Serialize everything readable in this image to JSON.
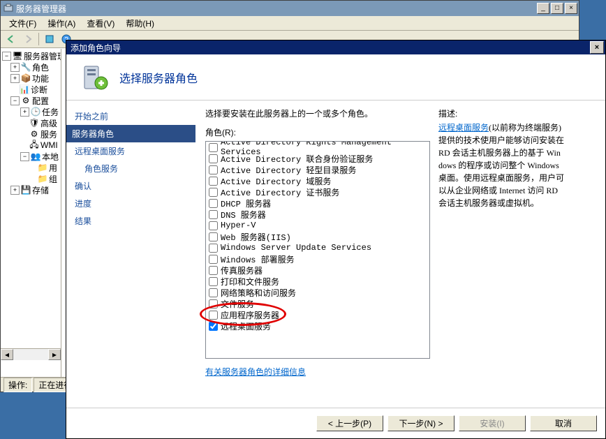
{
  "parent": {
    "title": "服务器管理器",
    "menu": {
      "file": "文件(F)",
      "action": "操作(A)",
      "view": "查看(V)",
      "help": "帮助(H)"
    },
    "status_label": "操作:",
    "status_value": "正在进行"
  },
  "tree": {
    "root": "服务器管理",
    "roles": "角色",
    "features": "功能",
    "diag": "诊断",
    "config": "配置",
    "task": "任务",
    "adv": "高级",
    "svc": "服务",
    "wmi": "WMI",
    "local": "本地",
    "usr": "用",
    "grp": "组",
    "storage": "存储"
  },
  "dialog": {
    "title": "添加角色向导",
    "heading": "选择服务器角色",
    "nav": {
      "before": "开始之前",
      "roles": "服务器角色",
      "rds": "远程桌面服务",
      "rsvc": "角色服务",
      "confirm": "确认",
      "progress": "进度",
      "result": "结果"
    },
    "prompt": "选择要安装在此服务器上的一个或多个角色。",
    "roles_label": "角色(R):",
    "roles": [
      {
        "label": "Active Directory Rights Management Services",
        "checked": false
      },
      {
        "label": "Active Directory 联合身份验证服务",
        "checked": false
      },
      {
        "label": "Active Directory 轻型目录服务",
        "checked": false
      },
      {
        "label": "Active Directory 域服务",
        "checked": false
      },
      {
        "label": "Active Directory 证书服务",
        "checked": false
      },
      {
        "label": "DHCP 服务器",
        "checked": false
      },
      {
        "label": "DNS 服务器",
        "checked": false
      },
      {
        "label": "Hyper-V",
        "checked": false
      },
      {
        "label": "Web 服务器(IIS)",
        "checked": false
      },
      {
        "label": "Windows Server Update Services",
        "checked": false
      },
      {
        "label": "Windows 部署服务",
        "checked": false
      },
      {
        "label": "传真服务器",
        "checked": false
      },
      {
        "label": "打印和文件服务",
        "checked": false
      },
      {
        "label": "网络策略和访问服务",
        "checked": false
      },
      {
        "label": "文件服务",
        "checked": false
      },
      {
        "label": "应用程序服务器",
        "checked": false
      },
      {
        "label": "远程桌面服务",
        "checked": true
      }
    ],
    "desc_heading": "描述:",
    "desc_link": "远程桌面服务",
    "desc_rest": "(以前称为终端服务) 提供的技术使用户能够访问安装在 RD 会话主机服务器上的基于 Windows 的程序或访问整个 Windows 桌面。使用远程桌面服务，用户可以从企业网络或 Internet 访问 RD 会话主机服务器或虚拟机。",
    "more_link": "有关服务器角色的详细信息",
    "buttons": {
      "prev": "< 上一步(P)",
      "next": "下一步(N) >",
      "install": "安装(I)",
      "cancel": "取消"
    }
  }
}
